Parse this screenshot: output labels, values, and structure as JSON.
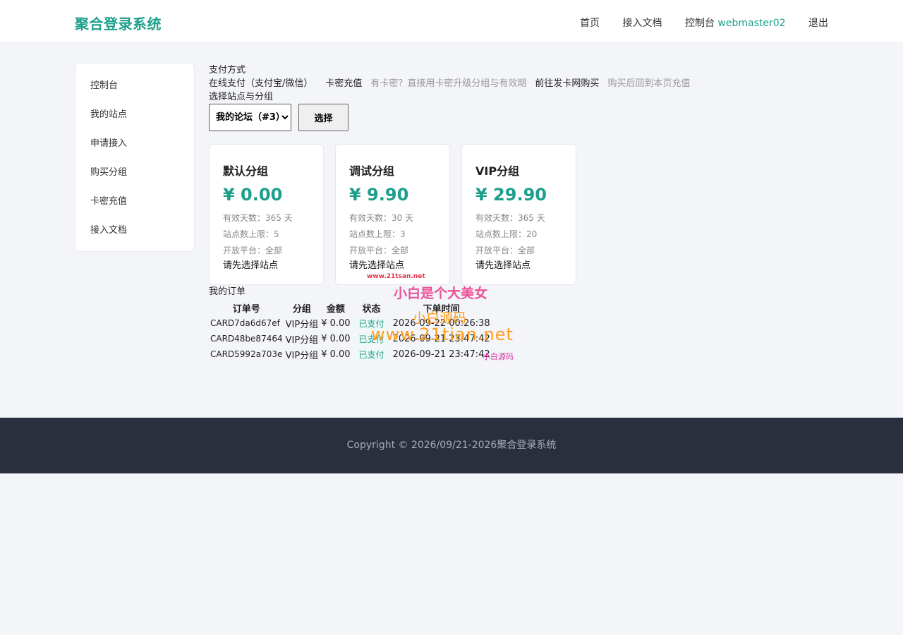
{
  "header": {
    "brand": "聚合登录系统",
    "nav": {
      "home": "首页",
      "docs": "接入文档",
      "console": "控制台",
      "username": "webmaster02",
      "logout": "退出"
    }
  },
  "sidebar": {
    "items": [
      {
        "label": "控制台"
      },
      {
        "label": "我的站点"
      },
      {
        "label": "申请接入"
      },
      {
        "label": "购买分组"
      },
      {
        "label": "卡密充值"
      },
      {
        "label": "接入文档"
      }
    ]
  },
  "payment": {
    "heading": "支付方式",
    "online": "在线支付（支付宝/微信）",
    "card": "卡密充值",
    "card_hint": "有卡密？直接用卡密升级分组与有效期",
    "buy_link": "前往发卡网购买",
    "buy_hint": "购买后回到本页充值"
  },
  "site_select": {
    "heading": "选择站点与分组",
    "selected": "我的论坛（#3）",
    "button": "选择"
  },
  "plans": [
    {
      "name": "默认分组",
      "price": "¥ 0.00",
      "days": "有效天数：365 天",
      "limit": "站点数上限：5",
      "platform": "开放平台：全部",
      "hint": "请先选择站点"
    },
    {
      "name": "调试分组",
      "price": "¥ 9.90",
      "days": "有效天数：30 天",
      "limit": "站点数上限：3",
      "platform": "开放平台：全部",
      "hint": "请先选择站点"
    },
    {
      "name": "VIP分组",
      "price": "¥ 29.90",
      "days": "有效天数：365 天",
      "limit": "站点数上限：20",
      "platform": "开放平台：全部",
      "hint": "请先选择站点"
    }
  ],
  "orders": {
    "heading": "我的订单",
    "columns": [
      "订单号",
      "分组",
      "金额",
      "状态",
      "下单时间"
    ],
    "rows": [
      {
        "id": "CARD7da6d67ef",
        "group": "VIP分组",
        "amount": "¥ 0.00",
        "status": "已支付",
        "time": "2026-09-22 00:26:38"
      },
      {
        "id": "CARD48be87464",
        "group": "VIP分组",
        "amount": "¥ 0.00",
        "status": "已支付",
        "time": "2026-09-21 23:47:42"
      },
      {
        "id": "CARD5992a703e",
        "group": "VIP分组",
        "amount": "¥ 0.00",
        "status": "已支付",
        "time": "2026-09-21 23:47:42"
      }
    ]
  },
  "footer": {
    "copyright": "Copyright © 2026/09/21-2026聚合登录系统"
  },
  "watermarks": {
    "a": "小白是个大美女",
    "b": "小白源码",
    "c": "www.21tian.net",
    "d": "小白源码",
    "e": "www.21tsan.net"
  },
  "colors": {
    "accent": "#1c9f8b",
    "footer_bg": "#2a2f3d",
    "page_bg": "#f4f5f9"
  }
}
